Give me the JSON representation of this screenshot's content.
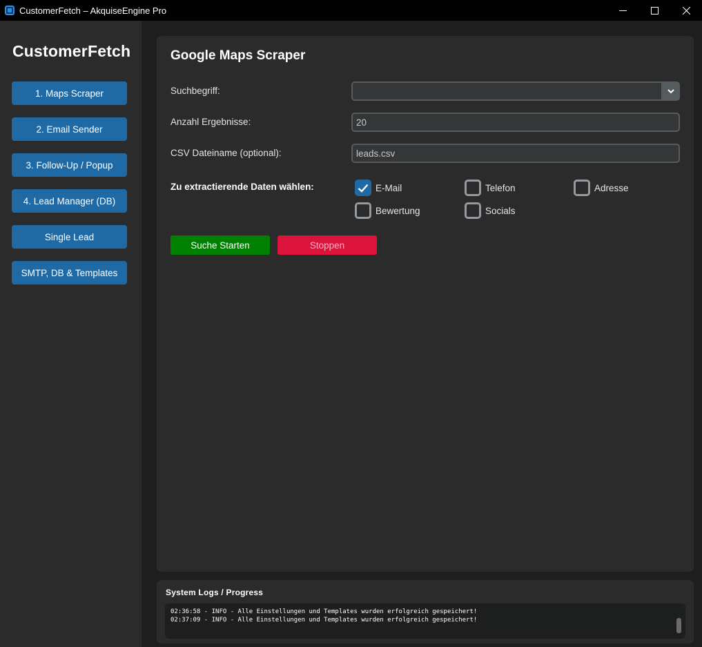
{
  "window": {
    "title": "CustomerFetch – AkquiseEngine Pro"
  },
  "sidebar": {
    "brand": "CustomerFetch",
    "items": [
      {
        "label": "1. Maps Scraper"
      },
      {
        "label": "2. Email Sender"
      },
      {
        "label": "3. Follow-Up / Popup"
      },
      {
        "label": "4. Lead Manager (DB)"
      },
      {
        "label": "Single Lead"
      },
      {
        "label": "SMTP, DB & Templates"
      }
    ]
  },
  "main": {
    "title": "Google Maps Scraper",
    "fields": {
      "search_label": "Suchbegriff:",
      "search_value": "",
      "count_label": "Anzahl Ergebnisse:",
      "count_value": "20",
      "csv_label": "CSV Dateiname (optional):",
      "csv_value": "leads.csv"
    },
    "data_label": "Zu extractierende Daten wählen:",
    "checkboxes": [
      {
        "label": "E-Mail",
        "checked": true
      },
      {
        "label": "Telefon",
        "checked": false
      },
      {
        "label": "Adresse",
        "checked": false
      },
      {
        "label": "Bewertung",
        "checked": false
      },
      {
        "label": "Socials",
        "checked": false
      }
    ],
    "buttons": {
      "start": "Suche Starten",
      "stop": "Stoppen"
    }
  },
  "logs": {
    "title": "System Logs / Progress",
    "lines": [
      "02:36:58 - INFO - Alle Einstellungen und Templates wurden erfolgreich gespeichert!",
      "02:37:09 - INFO - Alle Einstellungen und Templates wurden erfolgreich gespeichert!"
    ]
  },
  "colors": {
    "accent": "#1f6aa5",
    "start": "#008000",
    "stop": "#dc143c",
    "panel": "#2b2b2b",
    "background": "#1e1e1e"
  }
}
